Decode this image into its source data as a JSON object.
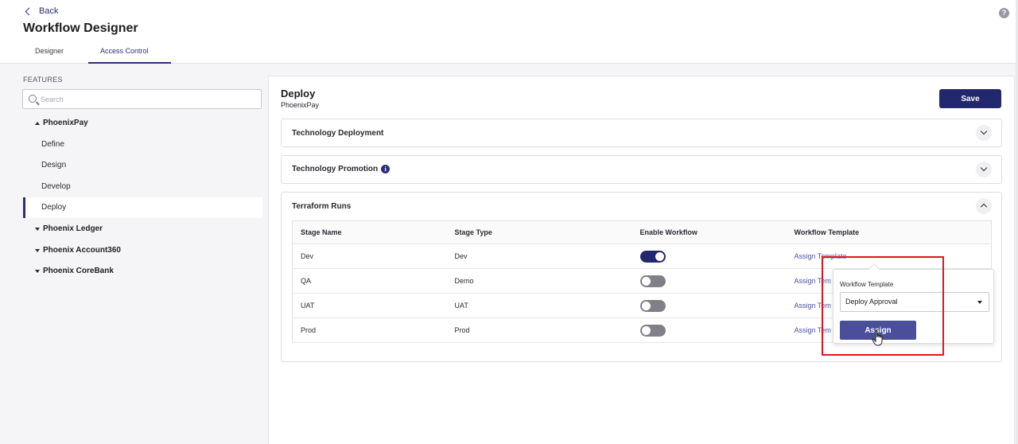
{
  "header": {
    "back_label": "Back",
    "title": "Workflow Designer",
    "help_icon": "?",
    "tabs": [
      {
        "label": "Designer",
        "active": false
      },
      {
        "label": "Access Control",
        "active": true
      }
    ]
  },
  "sidebar": {
    "section_label": "FEATURES",
    "search_placeholder": "Search",
    "groups": [
      {
        "label": "PhoenixPay",
        "expanded": true,
        "items": [
          "Define",
          "Design",
          "Develop",
          "Deploy"
        ],
        "selected": "Deploy"
      },
      {
        "label": "Phoenix Ledger",
        "expanded": false
      },
      {
        "label": "Phoenix Account360",
        "expanded": false
      },
      {
        "label": "Phoenix CoreBank",
        "expanded": false
      }
    ]
  },
  "main": {
    "title": "Deploy",
    "subtitle": "PhoenixPay",
    "save_label": "Save",
    "sections": [
      {
        "title": "Technology Deployment",
        "expanded": false
      },
      {
        "title": "Technology Promotion",
        "expanded": false,
        "info_icon": "i"
      },
      {
        "title": "Terraform Runs",
        "expanded": true
      }
    ],
    "table": {
      "columns": [
        "Stage Name",
        "Stage Type",
        "Enable Workflow",
        "Workflow Template"
      ],
      "rows": [
        {
          "stage_name": "Dev",
          "stage_type": "Dev",
          "enabled": true,
          "template": "Assign Template"
        },
        {
          "stage_name": "QA",
          "stage_type": "Demo",
          "enabled": false,
          "template": "Assign Tem"
        },
        {
          "stage_name": "UAT",
          "stage_type": "UAT",
          "enabled": false,
          "template": "Assign Tem"
        },
        {
          "stage_name": "Prod",
          "stage_type": "Prod",
          "enabled": false,
          "template": "Assign Tem"
        }
      ]
    }
  },
  "popover": {
    "label": "Workflow Template",
    "selected_value": "Deploy Approval",
    "assign_label": "Assign"
  },
  "colors": {
    "primary": "#23276d",
    "highlight": "#e0141c",
    "assign_button": "#4b4f9a"
  }
}
